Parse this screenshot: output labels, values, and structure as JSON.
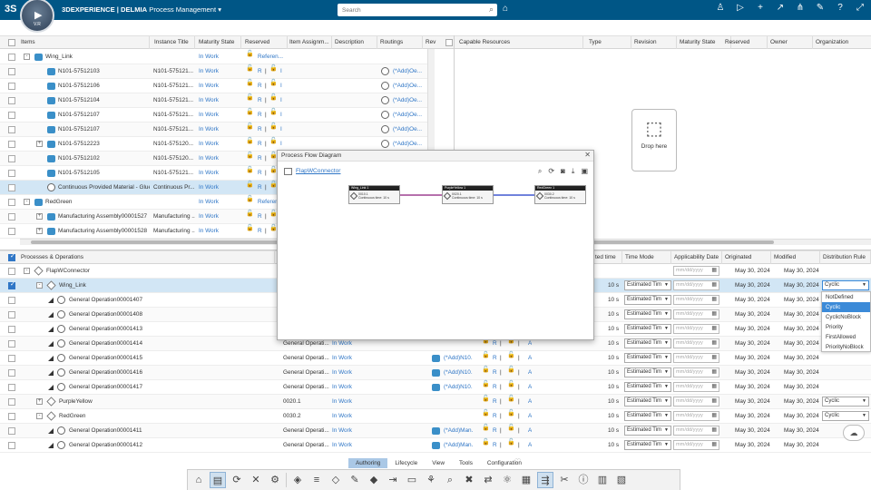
{
  "topbar": {
    "brand_prefix": "3DEXPERIENCE | DELMIA",
    "app_title": "Process Management",
    "search_placeholder": "Search",
    "compass_version": "V.R"
  },
  "items_grid": {
    "headers": [
      "Items",
      "Instance Title",
      "Maturity State",
      "Reserved",
      "Item Assignm...",
      "Description",
      "Routings",
      "Rev"
    ],
    "rows": [
      {
        "name": "Wing_Link",
        "instance": "",
        "state": "In Work",
        "reserved": "Referen...",
        "level": 0,
        "toggle": "-",
        "icon": "assy"
      },
      {
        "name": "N101-57512103",
        "instance": "N101-575121...",
        "state": "In Work",
        "reserved": "R",
        "routing": "(*Add)Oe...",
        "level": 1,
        "icon": "part"
      },
      {
        "name": "N101-57512106",
        "instance": "N101-575121...",
        "state": "In Work",
        "reserved": "R",
        "routing": "(*Add)Oe...",
        "level": 1,
        "icon": "part"
      },
      {
        "name": "N101-57512104",
        "instance": "N101-575121...",
        "state": "In Work",
        "reserved": "R",
        "routing": "(*Add)Oe...",
        "level": 1,
        "icon": "part"
      },
      {
        "name": "N101-57512107",
        "instance": "N101-575121...",
        "state": "In Work",
        "reserved": "R",
        "routing": "(*Add)Oe...",
        "level": 1,
        "icon": "part"
      },
      {
        "name": "N101-57512107",
        "instance": "N101-575121...",
        "state": "In Work",
        "reserved": "R",
        "routing": "(*Add)Oe...",
        "level": 1,
        "icon": "part"
      },
      {
        "name": "N101-57512223",
        "instance": "N101-575120...",
        "state": "In Work",
        "reserved": "R",
        "routing": "(*Add)Oe...",
        "level": 1,
        "toggle": "+",
        "icon": "part"
      },
      {
        "name": "N101-57512102",
        "instance": "N101-575120...",
        "state": "In Work",
        "reserved": "R",
        "routing": "(*Add)Oe...",
        "level": 1,
        "icon": "part"
      },
      {
        "name": "N101-57512105",
        "instance": "N101-575121...",
        "state": "In Work",
        "reserved": "R",
        "routing": "(*Add)Oe...",
        "level": 1,
        "icon": "part"
      },
      {
        "name": "Continuous Provided Material - Glue",
        "instance": "Continuous Pr...",
        "state": "In Work",
        "reserved": "R",
        "routing": "",
        "level": 1,
        "icon": "mat",
        "selected": true
      },
      {
        "name": "RedGreen",
        "instance": "",
        "state": "In Work",
        "reserved": "Referen...",
        "level": 0,
        "toggle": "-",
        "icon": "assy"
      },
      {
        "name": "Manufacturing Assembly00001527",
        "instance": "Manufacturing ...",
        "state": "In Work",
        "reserved": "R",
        "level": 1,
        "toggle": "+",
        "icon": "part"
      },
      {
        "name": "Manufacturing Assembly00001528",
        "instance": "Manufacturing ...",
        "state": "In Work",
        "reserved": "R",
        "level": 1,
        "toggle": "+",
        "icon": "part"
      }
    ]
  },
  "resources_grid": {
    "headers": [
      "Capable Resources",
      "Type",
      "Revision",
      "Maturity State",
      "Reserved",
      "Owner",
      "Organization"
    ],
    "drop_label": "Drop here"
  },
  "process_grid": {
    "headers": [
      "Processes & Operations",
      "ted time",
      "Time Mode",
      "Applicability Date",
      "Originated",
      "Modified",
      "Distribution Rule"
    ],
    "rows": [
      {
        "name": "FlapWConnector",
        "time": "",
        "mode": "",
        "orig": "May 30, 2024",
        "mod": "May 30, 2024",
        "rule": "",
        "level": 0,
        "toggle": "-",
        "icon": "sys"
      },
      {
        "name": "Wing_Link",
        "time": "10 s",
        "mode": "Estimated Tim",
        "orig": "May 30, 2024",
        "mod": "May 30, 2024",
        "rule": "Cyclic",
        "level": 1,
        "toggle": "-",
        "icon": "sys",
        "selected": true
      },
      {
        "name": "General Operation00001407",
        "time": "10 s",
        "mode": "Estimated Tim",
        "orig": "May 30, 2024",
        "mod": "May 30, 2024",
        "level": 2,
        "icon": "op"
      },
      {
        "name": "General Operation00001408",
        "time": "10 s",
        "mode": "Estimated Tim",
        "orig": "May 30, 2024",
        "mod": "May 30, 2024",
        "level": 2,
        "icon": "op"
      },
      {
        "name": "General Operation00001413",
        "time": "10 s",
        "mode": "Estimated Tim",
        "orig": "May 30, 2024",
        "mod": "May 30, 2024",
        "level": 2,
        "icon": "op"
      },
      {
        "name": "General Operation00001414",
        "type": "General Operati...",
        "state": "In Work",
        "time": "10 s",
        "mode": "Estimated Tim",
        "orig": "May 30, 2024",
        "mod": "May 30, 2024",
        "level": 2,
        "icon": "op"
      },
      {
        "name": "General Operation00001415",
        "type": "General Operati...",
        "state": "In Work",
        "res": "(*Add)N10...",
        "time": "10 s",
        "mode": "Estimated Tim",
        "orig": "May 30, 2024",
        "mod": "May 30, 2024",
        "level": 2,
        "icon": "op"
      },
      {
        "name": "General Operation00001416",
        "type": "General Operati...",
        "state": "In Work",
        "res": "(*Add)N10...",
        "time": "10 s",
        "mode": "Estimated Tim",
        "orig": "May 30, 2024",
        "mod": "May 30, 2024",
        "level": 2,
        "icon": "op"
      },
      {
        "name": "General Operation00001417",
        "type": "General Operati...",
        "state": "In Work",
        "res": "(*Add)N10...",
        "time": "10 s",
        "mode": "Estimated Tim",
        "orig": "May 30, 2024",
        "mod": "May 30, 2024",
        "level": 2,
        "icon": "op"
      },
      {
        "name": "PurpleYellow",
        "type": "0020.1",
        "state": "In Work",
        "time": "10 s",
        "mode": "Estimated Tim",
        "orig": "May 30, 2024",
        "mod": "May 30, 2024",
        "rule": "Cyclic",
        "level": 1,
        "toggle": "+",
        "icon": "sys"
      },
      {
        "name": "RedGreen",
        "type": "0030.2",
        "state": "In Work",
        "time": "10 s",
        "mode": "Estimated Tim",
        "orig": "May 30, 2024",
        "mod": "May 30, 2024",
        "rule": "Cyclic",
        "level": 1,
        "toggle": "-",
        "icon": "sys"
      },
      {
        "name": "General Operation00001411",
        "type": "General Operati...",
        "state": "In Work",
        "res": "(*Add)Man...",
        "time": "10 s",
        "mode": "Estimated Tim",
        "orig": "May 30, 2024",
        "mod": "May 30, 2024",
        "level": 2,
        "icon": "op"
      },
      {
        "name": "General Operation00001412",
        "type": "General Operati...",
        "state": "In Work",
        "res": "(*Add)Man...",
        "time": "10 s",
        "mode": "Estimated Tim",
        "orig": "May 30, 2024",
        "mod": "May 30, 2024",
        "level": 2,
        "icon": "op"
      }
    ],
    "date_placeholder": "mm/dd/yyyy",
    "lock_label": "R",
    "link_label": "A"
  },
  "dialog": {
    "title": "Process Flow Diagram",
    "link": "FlapWConnector",
    "nodes": [
      {
        "head": "Wing_Link 1",
        "line1": "0010.1",
        "line2": "Continuous time: 10 s"
      },
      {
        "head": "PurpleYellow 1",
        "line1": "0020.1",
        "line2": "Continuous time: 10 s"
      },
      {
        "head": "RedGreen 1",
        "line1": "0030.2",
        "line2": "Continuous time: 10 s"
      }
    ]
  },
  "dropdown": {
    "options": [
      "NotDefined",
      "Cyclic",
      "CyclicNoBlock",
      "Priority",
      "FirstAllowed",
      "PriorityNoBlock"
    ],
    "highlighted": "Cyclic"
  },
  "bottom_tabs": [
    "Authoring",
    "Lifecycle",
    "View",
    "Tools",
    "Configuration"
  ],
  "active_tab": "Authoring"
}
